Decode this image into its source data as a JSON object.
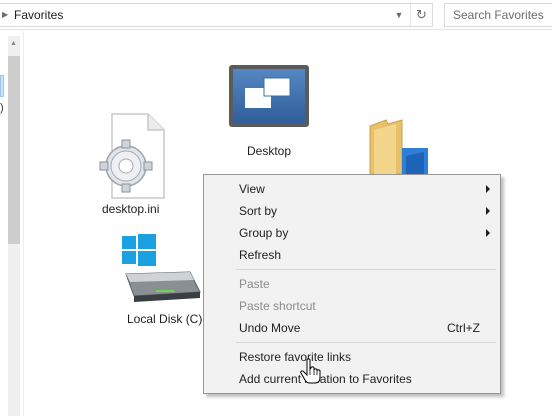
{
  "address_bar": {
    "path": "Favorites",
    "dropdown_icon": "chevron-down-icon",
    "refresh_icon": "refresh-icon"
  },
  "search": {
    "placeholder": "Search Favorites"
  },
  "items": {
    "desktop": {
      "label": "Desktop"
    },
    "desktop_ini": {
      "label": "desktop.ini"
    },
    "local_disk": {
      "label": "Local Disk (C)"
    }
  },
  "context_menu": {
    "view": "View",
    "sort_by": "Sort by",
    "group_by": "Group by",
    "refresh": "Refresh",
    "paste": "Paste",
    "paste_shortcut": "Paste shortcut",
    "undo_move": "Undo Move",
    "undo_move_shortcut": "Ctrl+Z",
    "restore_favorite_links": "Restore favorite links",
    "add_current_location": "Add current location to Favorites"
  },
  "left_pane": {
    "partial_text": ")"
  },
  "colors": {
    "menu_bg": "#f2f2f2",
    "disabled_text": "#8a8a8a",
    "windows_blue": "#1ba1e2"
  }
}
